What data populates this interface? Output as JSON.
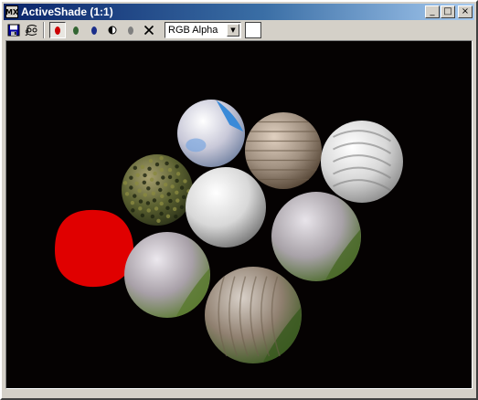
{
  "window": {
    "title": "ActiveShade (1:1)",
    "title_icon_glyph": "MX",
    "controls": {
      "minimize_glyph": "_",
      "maximize_glyph": "□",
      "close_glyph": "×"
    }
  },
  "toolbar": {
    "tools": [
      {
        "name": "save-bitmap-icon"
      },
      {
        "name": "clone-window-icon"
      },
      {
        "name": "red-channel-toggle",
        "color": "#cc0000",
        "pressed": true
      },
      {
        "name": "green-channel-toggle",
        "color": "#336633",
        "pressed": false
      },
      {
        "name": "blue-channel-toggle",
        "color": "#1a2e8a",
        "pressed": false
      },
      {
        "name": "monochrome-toggle",
        "pressed": false
      },
      {
        "name": "alpha-toggle",
        "pressed": false
      },
      {
        "name": "clear-icon"
      }
    ],
    "channel_select": {
      "value": "RGB Alpha",
      "arrow_glyph": "▼"
    },
    "swatch_color": "#ffffff"
  },
  "viewport": {
    "background": "#050202",
    "spheres": [
      {
        "name": "sphere-pale-blue",
        "material": "pale-blue",
        "colors": [
          "#ffffff",
          "#c8c8d8",
          "#7080a0"
        ]
      },
      {
        "name": "sphere-brick",
        "material": "brick",
        "colors": [
          "#e0d0c0",
          "#a09080",
          "#504030"
        ]
      },
      {
        "name": "sphere-chrome",
        "material": "chrome",
        "colors": [
          "#ffffff",
          "#d8d8d8",
          "#888888"
        ]
      },
      {
        "name": "sphere-green-noise",
        "material": "green-noise",
        "colors": [
          "#a8a070",
          "#5a6030",
          "#2a3018"
        ]
      },
      {
        "name": "sphere-white",
        "material": "white",
        "colors": [
          "#ffffff",
          "#d8d8d8",
          "#707070"
        ]
      },
      {
        "name": "sphere-gray-green-right",
        "material": "gray-green",
        "colors": [
          "#e8e4ea",
          "#a8a2a8",
          "#4a6a28"
        ]
      },
      {
        "name": "sphere-red",
        "material": "red",
        "colors": [
          "#ff1010",
          "#e00000",
          "#a00000"
        ]
      },
      {
        "name": "sphere-gray-green-left",
        "material": "gray-green",
        "colors": [
          "#ece8ee",
          "#a8a0a8",
          "#5a7a30"
        ]
      },
      {
        "name": "sphere-wood-green",
        "material": "wood-green",
        "colors": [
          "#d8d0c8",
          "#908070",
          "#3a5a20"
        ]
      }
    ]
  }
}
